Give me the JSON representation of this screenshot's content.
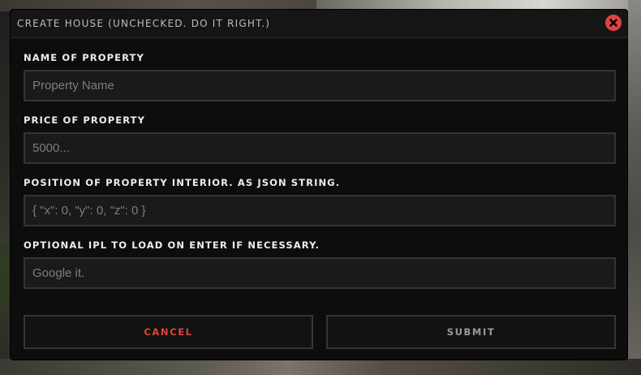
{
  "dialog": {
    "title": "CREATE HOUSE (UNCHECKED. DO IT RIGHT.)",
    "close_icon": "close-circle-icon",
    "close_color": "#e34040"
  },
  "fields": [
    {
      "label": "NAME OF PROPERTY",
      "value": "",
      "placeholder": "Property Name"
    },
    {
      "label": "PRICE OF PROPERTY",
      "value": "",
      "placeholder": "5000..."
    },
    {
      "label": "POSITION OF PROPERTY INTERIOR. AS JSON STRING.",
      "value": "",
      "placeholder": "{ \"x\": 0, \"y\": 0, \"z\": 0 }"
    },
    {
      "label": "OPTIONAL IPL TO LOAD ON ENTER IF NECESSARY.",
      "value": "",
      "placeholder": "Google it."
    }
  ],
  "buttons": {
    "cancel_label": "CANCEL",
    "submit_label": "SUBMIT",
    "cancel_color": "#e04336",
    "submit_color": "#9a9a9a"
  },
  "colors": {
    "panel_background": "#0d0d0d",
    "input_background": "#1a1a1a",
    "input_border": "#343434"
  }
}
